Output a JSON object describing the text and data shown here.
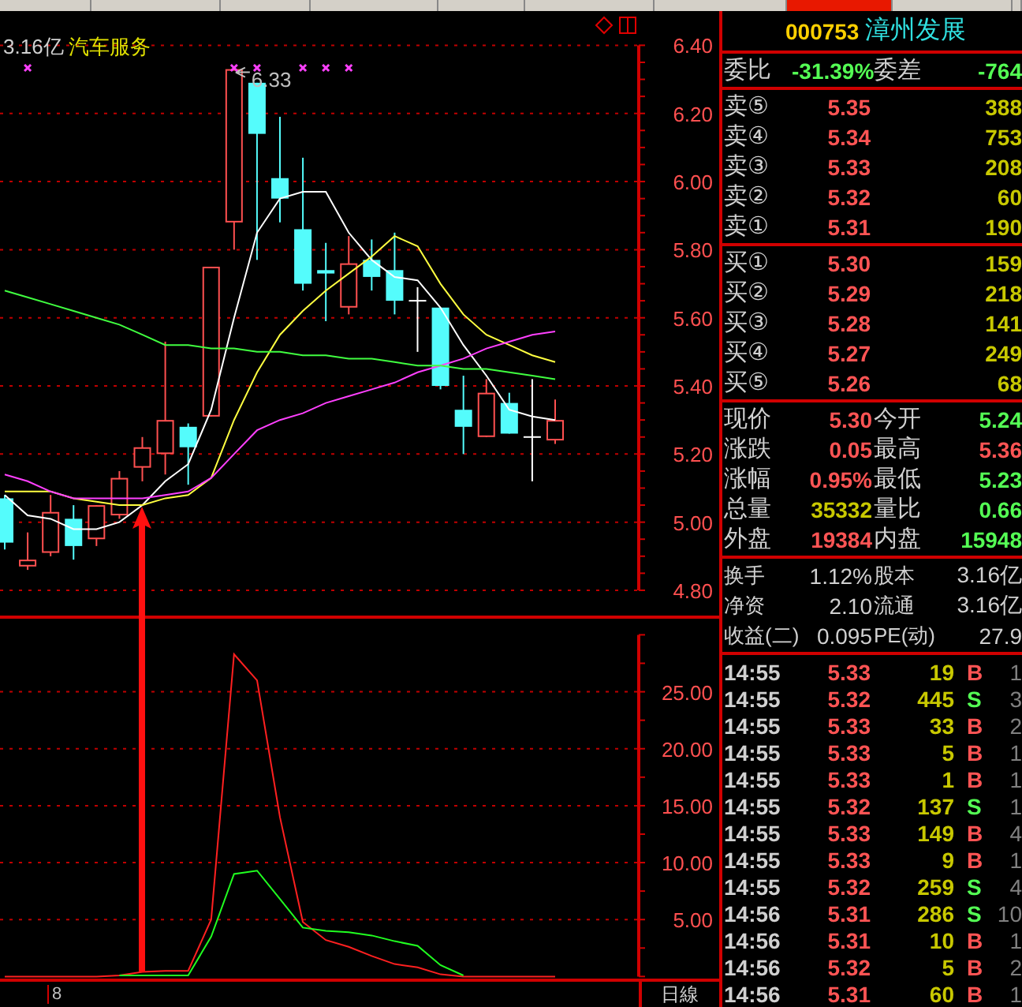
{
  "tab_strip": {
    "tabs": [
      {
        "selected": false
      },
      {
        "selected": false
      },
      {
        "selected": false
      },
      {
        "selected": false
      },
      {
        "selected": false
      },
      {
        "selected": false
      },
      {
        "selected": false
      },
      {
        "selected": true
      },
      {
        "selected": false
      },
      {
        "selected": false
      }
    ]
  },
  "stock": {
    "code": "000753",
    "name": "漳州发展"
  },
  "price_chart": {
    "caption_value": "3.16亿",
    "caption_sector": "汽车服务",
    "chart_data": {
      "type": "candlestick",
      "ylim": [
        4.8,
        6.4
      ],
      "grid": true,
      "categories": [
        null,
        null,
        null,
        null,
        null,
        null,
        null,
        null,
        null,
        null,
        null,
        null,
        null,
        null,
        null,
        null,
        null,
        null,
        null,
        null,
        null,
        null,
        null,
        null,
        null
      ],
      "yticks": [
        {
          "value": 4.8,
          "label": "4.80"
        },
        {
          "value": 5.0,
          "label": "5.00"
        },
        {
          "value": 5.2,
          "label": "5.20"
        },
        {
          "value": 5.4,
          "label": "5.40"
        },
        {
          "value": 5.6,
          "label": "5.60"
        },
        {
          "value": 5.8,
          "label": "5.80"
        },
        {
          "value": 6.0,
          "label": "6.00"
        },
        {
          "value": 6.2,
          "label": "6.20"
        },
        {
          "value": 6.4,
          "label": "6.40"
        }
      ],
      "ohlc": [
        [
          5.07,
          5.08,
          4.92,
          4.94
        ],
        [
          4.87,
          4.97,
          4.86,
          4.89
        ],
        [
          4.91,
          5.08,
          4.9,
          5.03
        ],
        [
          5.01,
          5.05,
          4.89,
          4.93
        ],
        [
          4.95,
          5.05,
          4.93,
          5.05
        ],
        [
          5.02,
          5.15,
          5.01,
          5.13
        ],
        [
          5.16,
          5.25,
          5.12,
          5.22
        ],
        [
          5.2,
          5.53,
          5.14,
          5.3
        ],
        [
          5.28,
          5.29,
          5.11,
          5.22
        ],
        [
          5.31,
          5.75,
          5.31,
          5.75
        ],
        [
          5.88,
          6.33,
          5.8,
          6.33
        ],
        [
          6.29,
          6.29,
          5.77,
          6.14
        ],
        [
          6.01,
          6.19,
          5.88,
          5.95
        ],
        [
          5.86,
          6.07,
          5.68,
          5.7
        ],
        [
          5.74,
          5.82,
          5.59,
          5.73
        ],
        [
          5.63,
          5.84,
          5.61,
          5.76
        ],
        [
          5.77,
          5.83,
          5.68,
          5.72
        ],
        [
          5.74,
          5.85,
          5.61,
          5.65
        ],
        [
          5.65,
          5.69,
          5.5,
          5.65
        ],
        [
          5.63,
          5.63,
          5.39,
          5.4
        ],
        [
          5.33,
          5.43,
          5.2,
          5.28
        ],
        [
          5.25,
          5.42,
          5.25,
          5.38
        ],
        [
          5.35,
          5.38,
          5.26,
          5.26
        ],
        [
          5.25,
          5.42,
          5.12,
          5.25
        ],
        [
          5.24,
          5.36,
          5.23,
          5.3
        ]
      ],
      "series": [
        {
          "type": "line",
          "color": "#ffffff",
          "values": [
            5.08,
            5.02,
            5.01,
            4.98,
            4.98,
            5.0,
            5.05,
            5.12,
            5.17,
            5.33,
            5.6,
            5.85,
            5.95,
            5.97,
            5.97,
            5.85,
            5.77,
            5.72,
            5.71,
            5.63,
            5.52,
            5.43,
            5.33,
            5.31,
            5.3
          ]
        },
        {
          "type": "line",
          "color": "#ffff40",
          "values": [
            5.09,
            5.09,
            5.09,
            5.07,
            5.06,
            5.05,
            5.05,
            5.07,
            5.08,
            5.13,
            5.3,
            5.44,
            5.55,
            5.62,
            5.68,
            5.73,
            5.78,
            5.84,
            5.81,
            5.7,
            5.61,
            5.55,
            5.52,
            5.49,
            5.47
          ]
        },
        {
          "type": "line",
          "color": "#ff40ff",
          "values": [
            5.14,
            5.12,
            5.09,
            5.07,
            5.07,
            5.07,
            5.07,
            5.08,
            5.09,
            5.13,
            5.2,
            5.27,
            5.3,
            5.32,
            5.35,
            5.37,
            5.39,
            5.41,
            5.44,
            5.46,
            5.48,
            5.51,
            5.53,
            5.55,
            5.56
          ]
        },
        {
          "type": "line",
          "color": "#40ff40",
          "values": [
            5.68,
            5.66,
            5.64,
            5.62,
            5.6,
            5.58,
            5.55,
            5.52,
            5.52,
            5.51,
            5.51,
            5.5,
            5.5,
            5.49,
            5.49,
            5.48,
            5.48,
            5.47,
            5.46,
            5.46,
            5.45,
            5.45,
            5.44,
            5.43,
            5.42
          ]
        }
      ],
      "annotations": [
        {
          "text": "6.33"
        }
      ]
    }
  },
  "indicator_chart": {
    "chart_data": {
      "type": "line",
      "ylim": [
        0,
        30
      ],
      "grid": true,
      "categories": [
        null,
        null,
        null,
        null,
        null,
        null,
        null,
        null,
        null,
        null,
        null,
        null,
        null,
        null,
        null,
        null,
        null,
        null,
        null,
        null,
        null,
        null,
        null,
        null,
        null
      ],
      "yticks": [
        {
          "value": 5,
          "label": "5.00"
        },
        {
          "value": 10,
          "label": "10.00"
        },
        {
          "value": 15,
          "label": "15.00"
        },
        {
          "value": 20,
          "label": "20.00"
        },
        {
          "value": 25,
          "label": "25.00"
        }
      ],
      "series": [
        {
          "color": "#ff2020",
          "values": [
            0,
            0,
            0,
            0,
            0,
            0.1,
            0.4,
            0.5,
            0.5,
            5.0,
            28.3,
            26.0,
            14.0,
            4.8,
            3.2,
            2.6,
            1.8,
            1.1,
            0.8,
            0.2,
            0,
            0,
            0,
            0,
            0
          ]
        },
        {
          "color": "#20ff20",
          "values": [
            null,
            null,
            null,
            null,
            null,
            0.1,
            0.1,
            0.1,
            0.1,
            3.5,
            9.0,
            9.3,
            6.8,
            4.3,
            4.0,
            3.9,
            3.6,
            3.1,
            2.7,
            1.0,
            0.1,
            null,
            null,
            null,
            null
          ]
        }
      ]
    }
  },
  "bottom_bar": {
    "date_label": "8",
    "period": "日線"
  },
  "order_ratio": [
    {
      "label": "委比",
      "value": "-31.39%",
      "kind": "down"
    },
    {
      "label": "委差",
      "value": "-764",
      "kind": "down"
    }
  ],
  "asks": [
    {
      "label": "卖⑤",
      "price": "5.35",
      "volume": "388"
    },
    {
      "label": "卖④",
      "price": "5.34",
      "volume": "753"
    },
    {
      "label": "卖③",
      "price": "5.33",
      "volume": "208"
    },
    {
      "label": "卖②",
      "price": "5.32",
      "volume": "60"
    },
    {
      "label": "卖①",
      "price": "5.31",
      "volume": "190"
    }
  ],
  "bids": [
    {
      "label": "买①",
      "price": "5.30",
      "volume": "159"
    },
    {
      "label": "买②",
      "price": "5.29",
      "volume": "218"
    },
    {
      "label": "买③",
      "price": "5.28",
      "volume": "141"
    },
    {
      "label": "买④",
      "price": "5.27",
      "volume": "249"
    },
    {
      "label": "买⑤",
      "price": "5.26",
      "volume": "68"
    }
  ],
  "quote": [
    [
      {
        "label": "现价",
        "value": "5.30",
        "kind": "up"
      },
      {
        "label": "今开",
        "value": "5.24",
        "kind": "down"
      }
    ],
    [
      {
        "label": "涨跌",
        "value": "0.05",
        "kind": "up"
      },
      {
        "label": "最高",
        "value": "5.36",
        "kind": "up"
      }
    ],
    [
      {
        "label": "涨幅",
        "value": "0.95%",
        "kind": "up"
      },
      {
        "label": "最低",
        "value": "5.23",
        "kind": "down"
      }
    ],
    [
      {
        "label": "总量",
        "value": "35332",
        "kind": "volume"
      },
      {
        "label": "量比",
        "value": "0.66",
        "kind": "down"
      }
    ],
    [
      {
        "label": "外盘",
        "value": "19384",
        "kind": "up"
      },
      {
        "label": "内盘",
        "value": "15948",
        "kind": "down"
      }
    ]
  ],
  "fundamentals": [
    [
      {
        "label": "换手",
        "value": "1.12%",
        "kind": "neutral"
      },
      {
        "label": "股本",
        "value": "3.16亿",
        "kind": "neutral"
      }
    ],
    [
      {
        "label": "净资",
        "value": "2.10",
        "kind": "neutral"
      },
      {
        "label": "流通",
        "value": "3.16亿",
        "kind": "neutral"
      }
    ],
    [
      {
        "label": "收益(二)",
        "value": "0.095",
        "kind": "neutral"
      },
      {
        "label": "PE(动)",
        "value": "27.9",
        "kind": "neutral"
      }
    ]
  ],
  "ticks": [
    {
      "time": "14:55",
      "price": "5.33",
      "volume": "19",
      "side": "B",
      "kind": "buy",
      "count": "1"
    },
    {
      "time": "14:55",
      "price": "5.32",
      "volume": "445",
      "side": "S",
      "kind": "sell",
      "count": "3"
    },
    {
      "time": "14:55",
      "price": "5.33",
      "volume": "33",
      "side": "B",
      "kind": "buy",
      "count": "2"
    },
    {
      "time": "14:55",
      "price": "5.33",
      "volume": "5",
      "side": "B",
      "kind": "buy",
      "count": "1"
    },
    {
      "time": "14:55",
      "price": "5.33",
      "volume": "1",
      "side": "B",
      "kind": "buy",
      "count": "1"
    },
    {
      "time": "14:55",
      "price": "5.32",
      "volume": "137",
      "side": "S",
      "kind": "sell",
      "count": "1"
    },
    {
      "time": "14:55",
      "price": "5.33",
      "volume": "149",
      "side": "B",
      "kind": "buy",
      "count": "4"
    },
    {
      "time": "14:55",
      "price": "5.33",
      "volume": "9",
      "side": "B",
      "kind": "buy",
      "count": "1"
    },
    {
      "time": "14:55",
      "price": "5.32",
      "volume": "259",
      "side": "S",
      "kind": "sell",
      "count": "4"
    },
    {
      "time": "14:56",
      "price": "5.31",
      "volume": "286",
      "side": "S",
      "kind": "sell",
      "count": "10"
    },
    {
      "time": "14:56",
      "price": "5.31",
      "volume": "10",
      "side": "B",
      "kind": "buy",
      "count": "1"
    },
    {
      "time": "14:56",
      "price": "5.32",
      "volume": "5",
      "side": "B",
      "kind": "buy",
      "count": "2"
    },
    {
      "time": "14:56",
      "price": "5.31",
      "volume": "60",
      "side": "B",
      "kind": "buy",
      "count": "1"
    }
  ]
}
